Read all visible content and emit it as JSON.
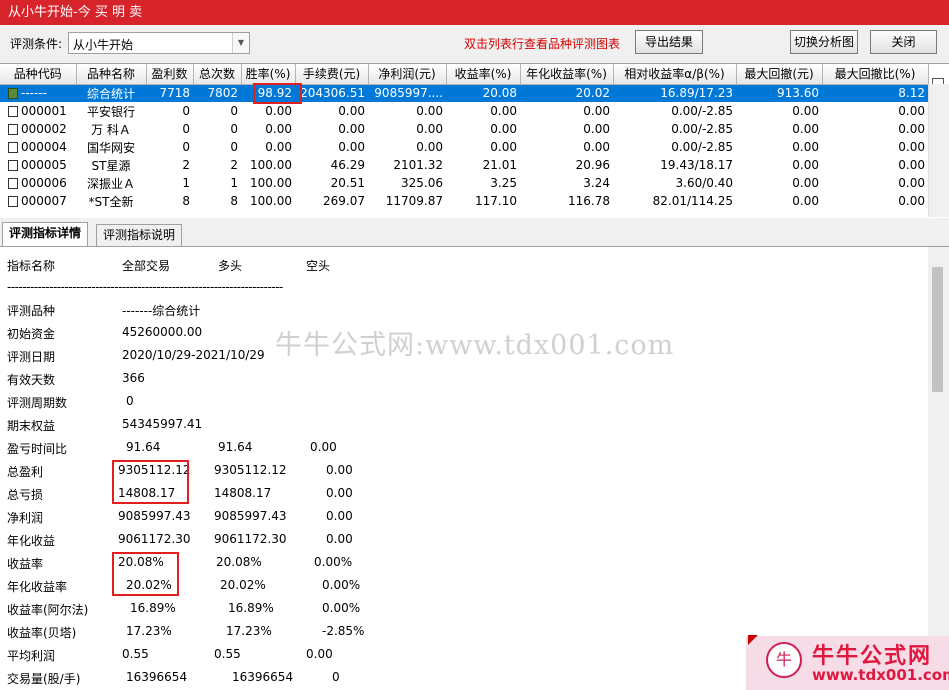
{
  "window": {
    "title": "从小牛开始-今 买 明 卖"
  },
  "toolbar": {
    "condition_label": "评测条件:",
    "condition_value": "从小牛开始",
    "hint": "双击列表行查看品种评测图表",
    "export_label": "导出结果",
    "switch_label": "切换分析图",
    "close_label": "关闭"
  },
  "grid": {
    "headers": [
      "品种代码",
      "品种名称",
      "盈利数",
      "总次数",
      "胜率(%)",
      "手续费(元)",
      "净利润(元)",
      "收益率(%)",
      "年化收益率(%)",
      "相对收益率α/β(%)",
      "最大回撤(元)",
      "最大回撤比(%)"
    ],
    "rows": [
      [
        "------",
        "综合统计",
        "7718",
        "7802",
        "98.92",
        "204306.51",
        "9085997....",
        "20.08",
        "20.02",
        "16.89/17.23",
        "913.60",
        "8.12"
      ],
      [
        "000001",
        "平安银行",
        "0",
        "0",
        "0.00",
        "0.00",
        "0.00",
        "0.00",
        "0.00",
        "0.00/-2.85",
        "0.00",
        "0.00"
      ],
      [
        "000002",
        "万 科Ａ",
        "0",
        "0",
        "0.00",
        "0.00",
        "0.00",
        "0.00",
        "0.00",
        "0.00/-2.85",
        "0.00",
        "0.00"
      ],
      [
        "000004",
        "国华网安",
        "0",
        "0",
        "0.00",
        "0.00",
        "0.00",
        "0.00",
        "0.00",
        "0.00/-2.85",
        "0.00",
        "0.00"
      ],
      [
        "000005",
        "ST星源",
        "2",
        "2",
        "100.00",
        "46.29",
        "2101.32",
        "21.01",
        "20.96",
        "19.43/18.17",
        "0.00",
        "0.00"
      ],
      [
        "000006",
        "深振业Ａ",
        "1",
        "1",
        "100.00",
        "20.51",
        "325.06",
        "3.25",
        "3.24",
        "3.60/0.40",
        "0.00",
        "0.00"
      ],
      [
        "000007",
        "*ST全新",
        "8",
        "8",
        "100.00",
        "269.07",
        "11709.87",
        "117.10",
        "116.78",
        "82.01/114.25",
        "0.00",
        "0.00"
      ]
    ]
  },
  "tabs": [
    "评测指标详情",
    "评测指标说明"
  ],
  "detail": {
    "col_headers": [
      "指标名称",
      "全部交易",
      "多头",
      "空头"
    ],
    "separator": "------------------------------------------------------------------------",
    "rows": [
      {
        "label": "评测品种",
        "v1": "-------综合统计",
        "v2": "",
        "v3": ""
      },
      {
        "label": "初始资金",
        "v1": "45260000.00",
        "v2": "",
        "v3": ""
      },
      {
        "label": "评测日期",
        "v1": "2020/10/29-2021/10/29",
        "v2": "",
        "v3": ""
      },
      {
        "label": "有效天数",
        "v1": "366",
        "v2": "",
        "v3": ""
      },
      {
        "label": "评测周期数",
        "v1": "0",
        "v2": "",
        "v3": ""
      },
      {
        "label": "期末权益",
        "v1": "54345997.41",
        "v2": "",
        "v3": ""
      },
      {
        "label": "盈亏时间比",
        "v1": "91.64",
        "v2": "91.64",
        "v3": "0.00"
      },
      {
        "label": "总盈利",
        "v1": "9305112.12",
        "v2": "9305112.12",
        "v3": "0.00"
      },
      {
        "label": "总亏损",
        "v1": "14808.17",
        "v2": "14808.17",
        "v3": "0.00"
      },
      {
        "label": "净利润",
        "v1": "9085997.43",
        "v2": "9085997.43",
        "v3": "0.00"
      },
      {
        "label": "年化收益",
        "v1": "9061172.30",
        "v2": "9061172.30",
        "v3": "0.00"
      },
      {
        "label": "收益率",
        "v1": "20.08%",
        "v2": "20.08%",
        "v3": "0.00%"
      },
      {
        "label": "年化收益率",
        "v1": "20.02%",
        "v2": "20.02%",
        "v3": "0.00%"
      },
      {
        "label": "收益率(阿尔法)",
        "v1": "16.89%",
        "v2": "16.89%",
        "v3": "0.00%"
      },
      {
        "label": "收益率(贝塔)",
        "v1": "17.23%",
        "v2": "17.23%",
        "v3": "-2.85%"
      },
      {
        "label": "平均利润",
        "v1": "0.55",
        "v2": "0.55",
        "v3": "0.00"
      },
      {
        "label": "交易量(股/手)",
        "v1": "16396654",
        "v2": "16396654",
        "v3": "0"
      }
    ]
  },
  "watermark": "牛牛公式网:www.tdx001.com",
  "logo": {
    "name": "牛牛公式网",
    "url": "www.tdx001.com",
    "brand_color": "#e01840"
  },
  "colors": {
    "title_bar": "#d7242b",
    "selection": "#0078d7",
    "highlight_box": "#e02020",
    "hint": "#d40000"
  }
}
